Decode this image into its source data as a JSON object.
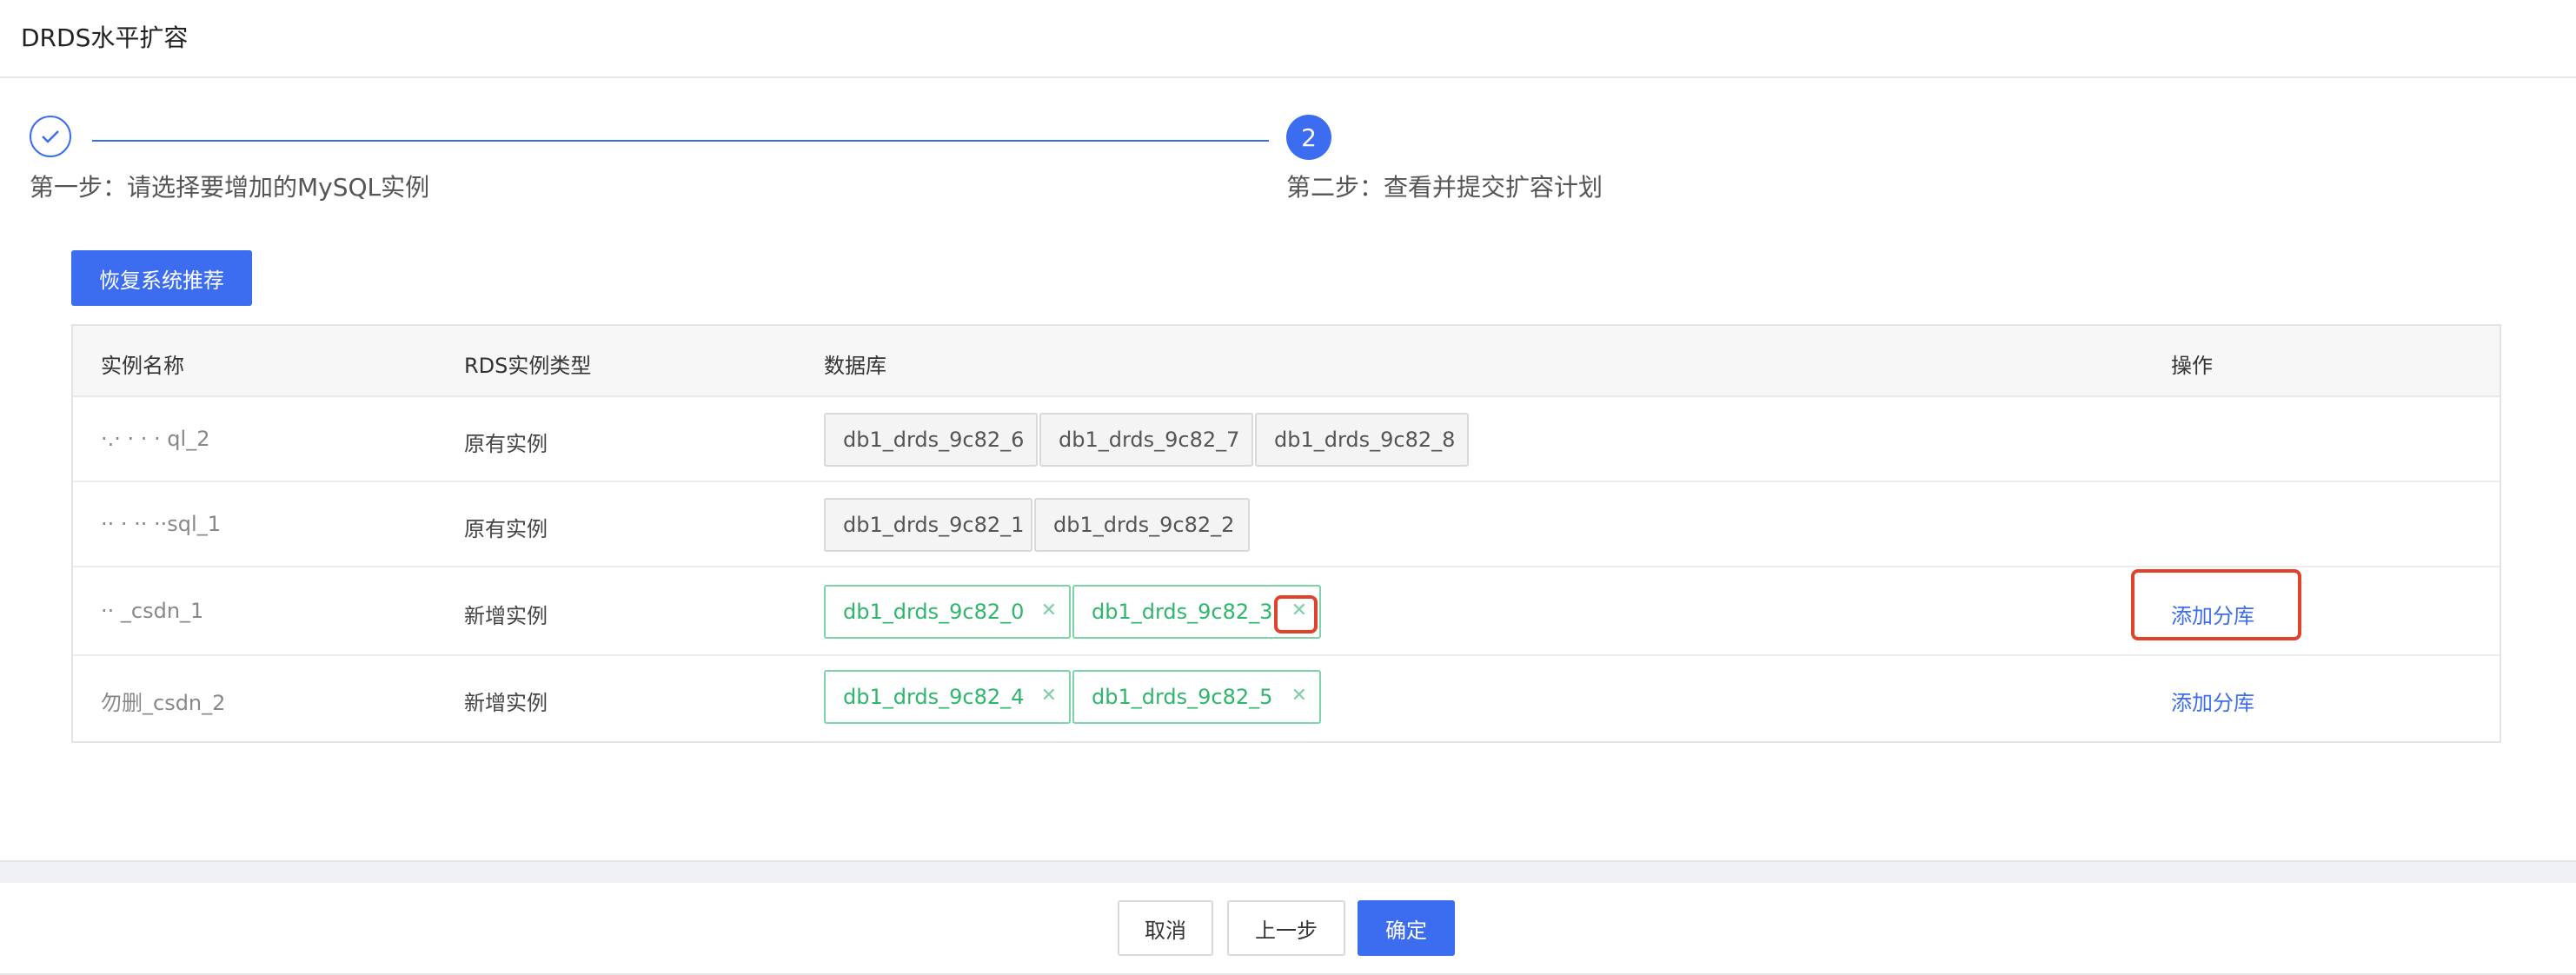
{
  "header": {
    "title": "DRDS水平扩容"
  },
  "steps": [
    {
      "label": "第一步：请选择要增加的MySQL实例",
      "status": "done"
    },
    {
      "number": "2",
      "label": "第二步：查看并提交扩容计划",
      "status": "current"
    }
  ],
  "restore_button": "恢复系统推荐",
  "table": {
    "columns": [
      "实例名称",
      "RDS实例类型",
      "数据库",
      "操作"
    ],
    "rows": [
      {
        "name": "·.· ·  ·  ·  ql_2",
        "type": "原有实例",
        "dbs": [
          "db1_drds_9c82_6",
          "db1_drds_9c82_7",
          "db1_drds_9c82_8"
        ],
        "action": ""
      },
      {
        "name": "·· ·  ··  ··sql_1",
        "type": "原有实例",
        "dbs": [
          "db1_drds_9c82_1",
          "db1_drds_9c82_2"
        ],
        "action": ""
      },
      {
        "name": "·· _csdn_1",
        "type": "新增实例",
        "dbs": [
          "db1_drds_9c82_0",
          "db1_drds_9c82_3"
        ],
        "action": "添加分库"
      },
      {
        "name": "勿删_csdn_2",
        "type": "新增实例",
        "dbs": [
          "db1_drds_9c82_4",
          "db1_drds_9c82_5"
        ],
        "action": "添加分库"
      }
    ]
  },
  "footer": {
    "cancel": "取消",
    "prev": "上一步",
    "confirm": "确定"
  },
  "colors": {
    "accent": "#3c6df0",
    "tag_green": "#2fb66d",
    "highlight": "#e0432b"
  }
}
